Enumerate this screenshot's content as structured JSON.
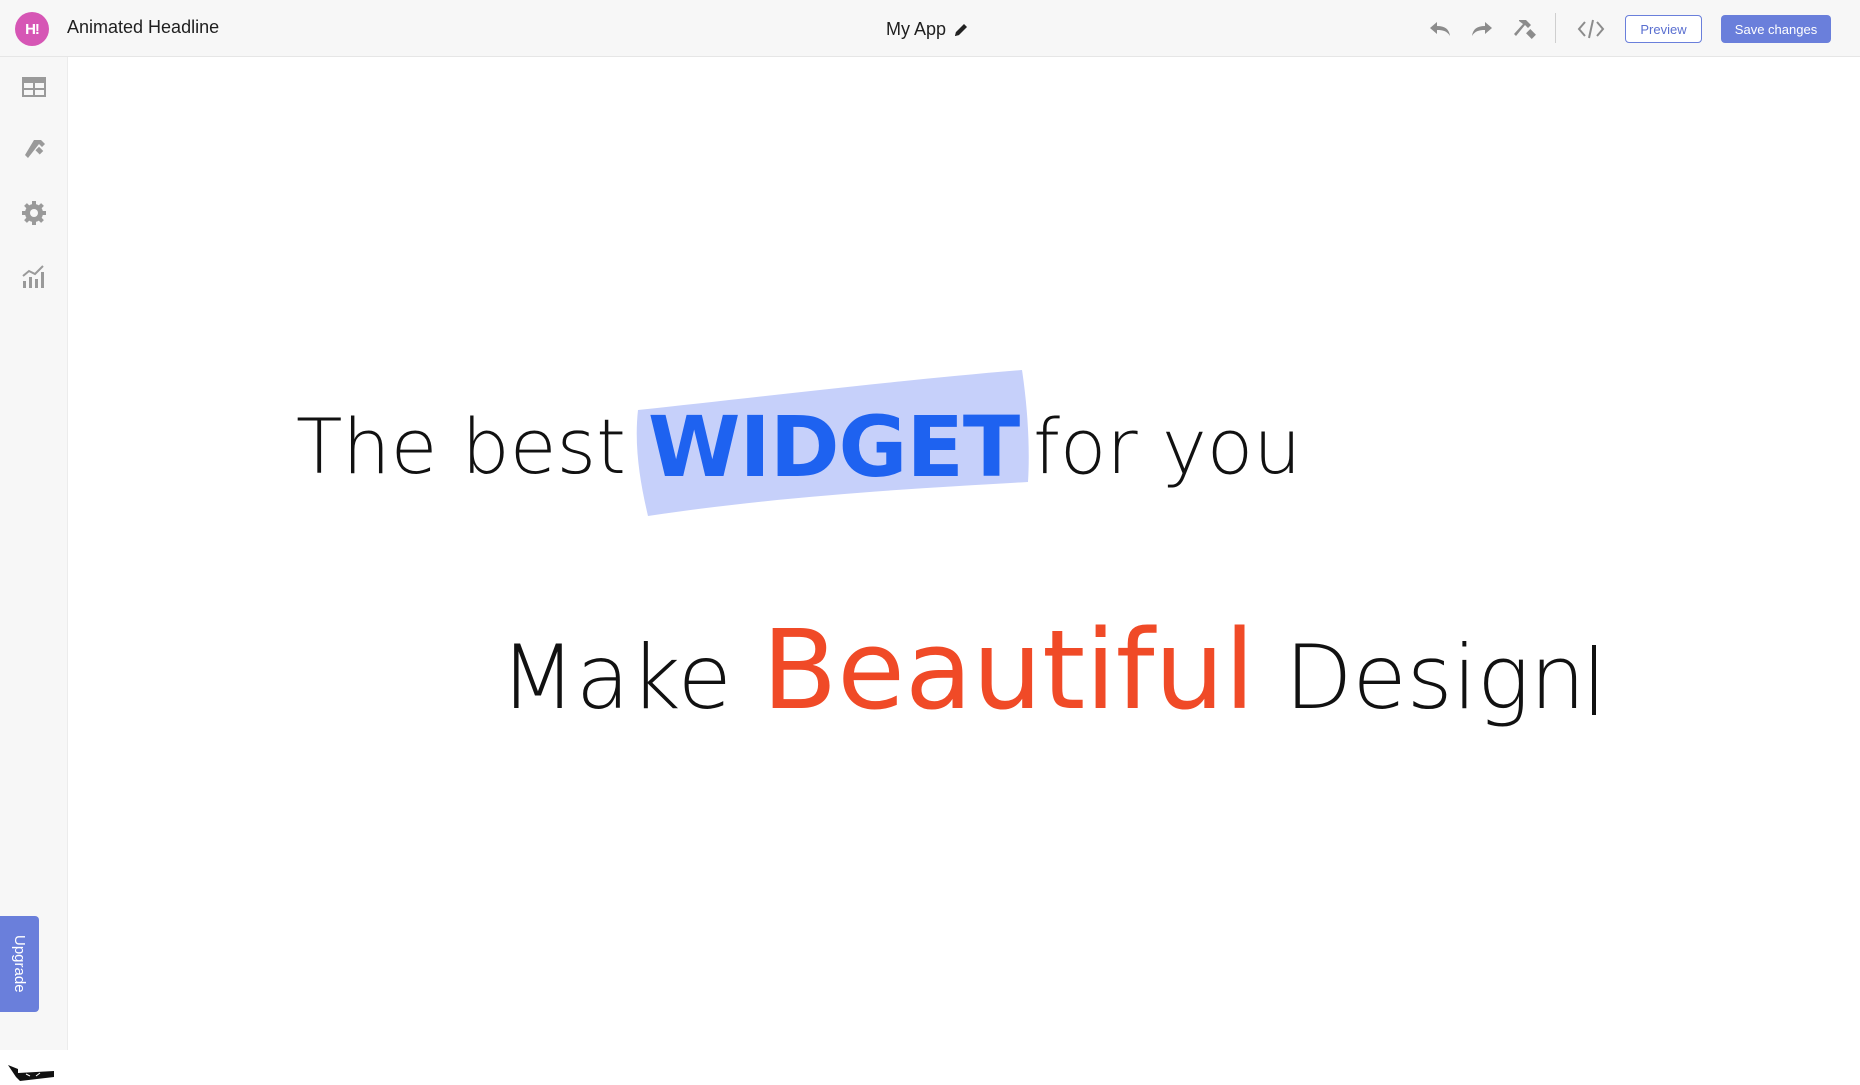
{
  "header": {
    "logo_text": "H!",
    "widget_name": "Animated Headline",
    "app_name": "My App",
    "preview_label": "Preview",
    "save_label": "Save changes",
    "icons": [
      "undo-icon",
      "redo-icon",
      "hammer-icon",
      "code-icon",
      "pencil-icon"
    ]
  },
  "sidebar": {
    "items": [
      {
        "icon": "layout-icon"
      },
      {
        "icon": "brush-icon"
      },
      {
        "icon": "gear-icon"
      },
      {
        "icon": "analytics-icon"
      }
    ],
    "upgrade_label": "Upgrade"
  },
  "canvas": {
    "headline1": {
      "before": "The best",
      "highlight": "WIDGET",
      "after": "for you",
      "highlight_color": "#1e62f0",
      "brush_color": "#c6d0fa"
    },
    "headline2": {
      "before": "Make",
      "accent": "Beautiful",
      "after": "Design",
      "accent_color": "#f04a27"
    }
  },
  "colors": {
    "accent": "#6a7fdb",
    "logo": "#d656b5",
    "chrome_bg": "#f7f7f7"
  }
}
